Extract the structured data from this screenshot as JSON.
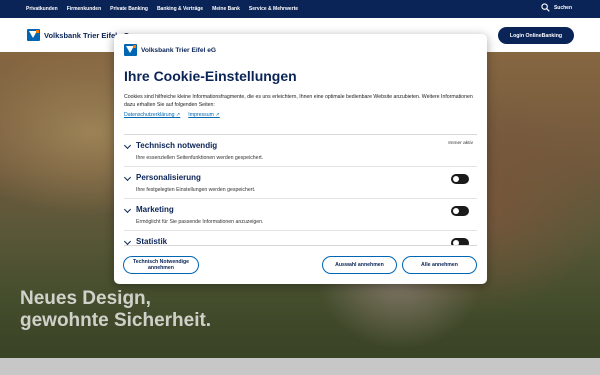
{
  "nav": {
    "items": [
      "Privatkunden",
      "Firmenkunden",
      "Private Banking",
      "Banking & Verträge",
      "Meine Bank",
      "Service & Mehrwerte"
    ],
    "search_label": "Suchen"
  },
  "header": {
    "bank_name": "Volksbank Trier Eifel eG",
    "login_label": "Login OnlineBanking"
  },
  "hero": {
    "line1": "Neues Design,",
    "line2": "gewohnte Sicherheit."
  },
  "dialog": {
    "bank_name": "Volksbank Trier Eifel eG",
    "title": "Ihre Cookie-Einstellungen",
    "text": "Cookies sind hilfreiche kleine Informationsfragmente, die es uns erleichtern, Ihnen eine optimale bedienbare Website anzubieten. Weitere Informationen dazu erhalten Sie auf folgenden Seiten:",
    "link_privacy": "Datenschutzerklärung",
    "link_imprint": "Impressum",
    "categories": [
      {
        "title": "Technisch notwendig",
        "desc": "Ihre essenziellen Seitenfunktionen werden gespeichert.",
        "state_text": "Immer aktiv"
      },
      {
        "title": "Personalisierung",
        "desc": "Ihre festgelegten Einstellungen werden gespeichert.",
        "enabled": false
      },
      {
        "title": "Marketing",
        "desc": "Ermöglicht für Sie passende Informationen anzuzeigen.",
        "enabled": false
      },
      {
        "title": "Statistik",
        "desc": "",
        "enabled": false
      }
    ],
    "btn_technical": "Technisch Notwendige annehmen",
    "btn_selection": "Auswahl annehmen",
    "btn_all": "Alle annehmen"
  },
  "colors": {
    "navy": "#0a2457",
    "brand_blue": "#0066b3",
    "brand_orange": "#f07d00"
  }
}
